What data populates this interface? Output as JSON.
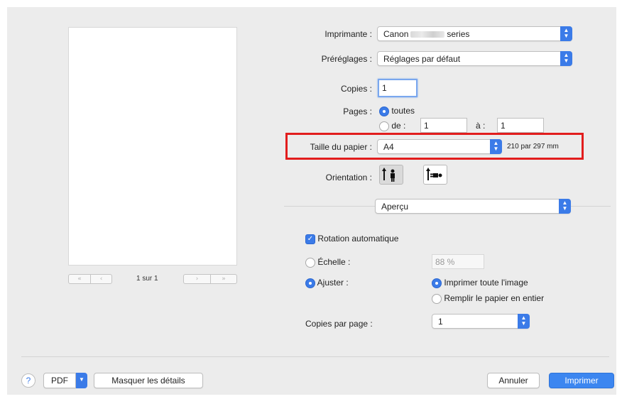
{
  "printer": {
    "label": "Imprimante :",
    "value_prefix": "Canon",
    "value_suffix": "series"
  },
  "presets": {
    "label": "Préréglages :",
    "value": "Réglages par défaut"
  },
  "copies": {
    "label": "Copies :",
    "value": "1"
  },
  "pages": {
    "label": "Pages :",
    "all_label": "toutes",
    "from_label": "de :",
    "from_value": "1",
    "to_label": "à :",
    "to_value": "1"
  },
  "paper_size": {
    "label": "Taille du papier :",
    "value": "A4",
    "dimensions": "210 par 297 mm"
  },
  "orientation": {
    "label": "Orientation :"
  },
  "section_popup": {
    "value": "Aperçu"
  },
  "auto_rotate": {
    "label": "Rotation automatique",
    "checked": true
  },
  "scale": {
    "label": "Échelle :",
    "value": "88 %"
  },
  "fit": {
    "label": "Ajuster :",
    "print_entire_label": "Imprimer toute l'image",
    "fill_paper_label": "Remplir le papier en entier"
  },
  "copies_per_page": {
    "label": "Copies par page :",
    "value": "1"
  },
  "preview": {
    "page_counter": "1 sur 1",
    "nav_first": "«",
    "nav_prev": "‹",
    "nav_next": "›",
    "nav_last": "»"
  },
  "footer": {
    "help": "?",
    "pdf": "PDF",
    "hide_details": "Masquer les détails",
    "cancel": "Annuler",
    "print": "Imprimer"
  },
  "colors": {
    "accent": "#3b7be8",
    "highlight": "#e21d1d"
  }
}
